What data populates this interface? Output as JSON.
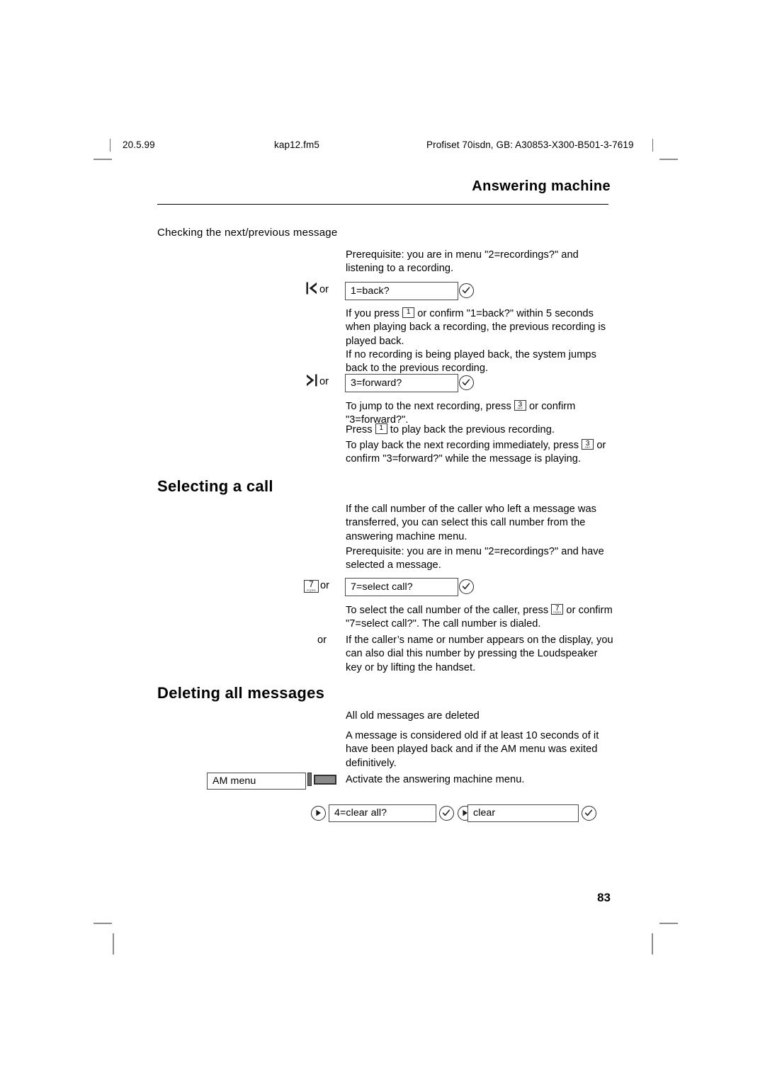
{
  "print_marks": {
    "note": "registration crop marks"
  },
  "file_header": {
    "date": "20.5.99",
    "filename": "kap12.fm5",
    "document": "Profiset 70isdn, GB: A30853-X300-B501-3-7619"
  },
  "running_head": "Answering machine",
  "page_number": "83",
  "sections": {
    "checking": {
      "subheading": "Checking the next/previous message",
      "intro": "Prerequisite: you are in menu \"2=recordings?\" and listening to a recording.",
      "back_row": {
        "transport_icon": "skip-back-icon",
        "or": "or",
        "display": "1=back?",
        "confirm_icon": "confirm-check-icon"
      },
      "back_text_1_a": "If you press ",
      "back_text_1_key": "1",
      "back_text_1_b": " or confirm \"1=back?\" within 5 seconds when playing back a recording, the previous recording is played back.",
      "back_text_2": "If no recording is being played back, the system jumps back to the previous recording.",
      "forward_row": {
        "transport_icon": "skip-forward-icon",
        "or": "or",
        "display": "3=forward?",
        "confirm_icon": "confirm-check-icon"
      },
      "fwd_text_1_a": "To jump to the next recording, press ",
      "fwd_text_1_key": "3",
      "fwd_text_1_b": " or confirm \"3=forward?\".",
      "fwd_text_2_a": "Press ",
      "fwd_text_2_key": "1",
      "fwd_text_2_b": " to play back the previous recording.",
      "fwd_text_3_a": "To play back the next recording immediately, press ",
      "fwd_text_3_key": "3",
      "fwd_text_3_b": " or confirm \"3=forward?\" while the message is playing."
    },
    "selecting_a_call": {
      "heading": "Selecting a call",
      "para_1": "If the call number of the caller who left a message was transferred, you can select this call number from the answering machine menu.",
      "para_2": "Prerequisite: you are in menu \"2=recordings?\" and have selected a message.",
      "select_row": {
        "key": "7",
        "key_sub": "PQRS",
        "or": "or",
        "display": "7=select call?",
        "confirm_icon": "confirm-check-icon"
      },
      "para_3_a": "To select the call number of the caller, press ",
      "para_3_key": "7",
      "para_3_b": " or confirm \"7=select call?\". The call number is dialed.",
      "or_label": "or",
      "para_4": "If the caller’s name or number appears on the display, you can also dial this number by pressing the Loudspeaker key or by lifting the handset."
    },
    "deleting_all": {
      "heading": "Deleting all messages",
      "para_1": "All old messages are deleted",
      "para_2": "A message is considered old if at least 10 seconds of it have been played back and if the AM menu was exited definitively.",
      "am_menu_row": {
        "display": "AM menu",
        "fkey_icon": "function-key-icon",
        "description": "Activate the answering machine menu."
      },
      "clear_row": {
        "scroll_icon_1": "scroll-next-icon",
        "display_1": "4=clear all?",
        "confirm_icon_1": "confirm-check-icon",
        "scroll_icon_2": "scroll-next-icon",
        "display_2": "clear",
        "confirm_icon_2": "confirm-check-icon"
      }
    }
  },
  "key_subs": {
    "one": "",
    "three": "DEF",
    "seven": "PQRS"
  }
}
